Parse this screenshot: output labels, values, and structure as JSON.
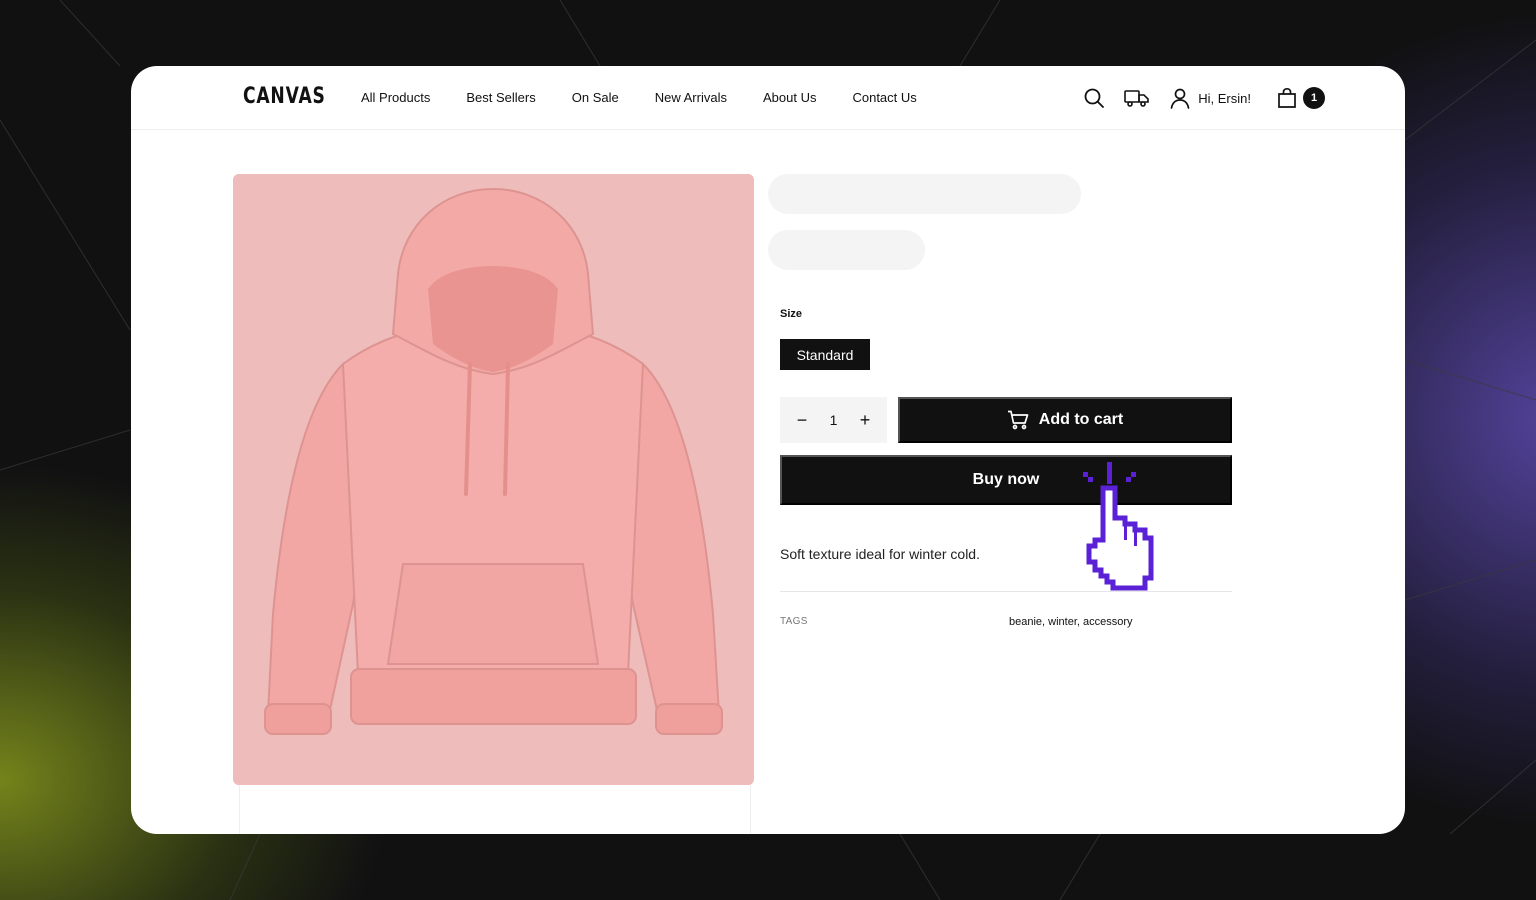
{
  "brand": {
    "logo_text": "CANVAS"
  },
  "nav": {
    "items": [
      {
        "label": "All Products"
      },
      {
        "label": "Best Sellers"
      },
      {
        "label": "On Sale"
      },
      {
        "label": "New Arrivals"
      },
      {
        "label": "About Us"
      },
      {
        "label": "Contact Us"
      }
    ]
  },
  "header": {
    "greeting": "Hi, Ersin!",
    "cart_count": "1",
    "icons": [
      "search-icon",
      "truck-icon",
      "user-icon",
      "bag-icon"
    ]
  },
  "product": {
    "image_subject": "pink hoodie",
    "size_label": "Size",
    "selected_size": "Standard",
    "quantity": "1",
    "qty_minus": "−",
    "qty_plus": "+",
    "add_to_cart_label": "Add to cart",
    "buy_now_label": "Buy now",
    "description": "Soft texture ideal for winter cold.",
    "tags_label": "TAGS",
    "tags_value": "beanie, winter, accessory"
  },
  "colors": {
    "accent_dark": "#111111",
    "pointer": "#5b21d6",
    "image_bg": "#efbcbc"
  }
}
